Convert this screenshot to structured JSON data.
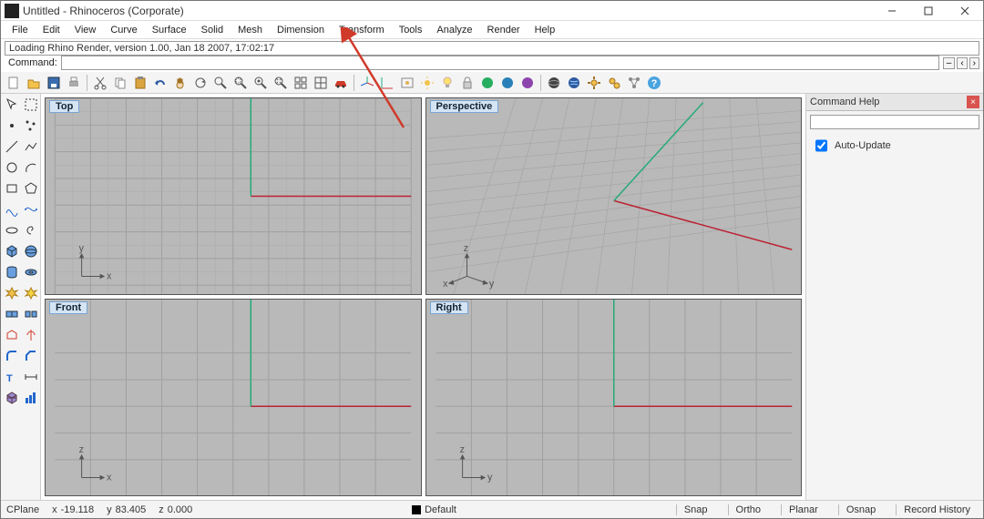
{
  "titlebar": {
    "title": "Untitled - Rhinoceros (Corporate)"
  },
  "menus": [
    "File",
    "Edit",
    "View",
    "Curve",
    "Surface",
    "Solid",
    "Mesh",
    "Dimension",
    "Transform",
    "Tools",
    "Analyze",
    "Render",
    "Help"
  ],
  "console_line": "Loading Rhino Render, version 1.00, Jan 18 2007, 17:02:17",
  "command_label": "Command:",
  "viewports": {
    "top": "Top",
    "perspective": "Perspective",
    "front": "Front",
    "right": "Right",
    "axis_x": "x",
    "axis_y": "y",
    "axis_z": "z"
  },
  "help": {
    "title": "Command Help",
    "auto_update": "Auto-Update"
  },
  "status": {
    "cplane": "CPlane",
    "x_label": "x",
    "x_val": "-19.118",
    "y_label": "y",
    "y_val": "83.405",
    "z_label": "z",
    "z_val": "0.000",
    "layer": "Default",
    "snap": "Snap",
    "ortho": "Ortho",
    "planar": "Planar",
    "osnap": "Osnap",
    "record": "Record History"
  },
  "icons": {
    "new": "#e0b050",
    "open": "#e0b050",
    "save": "#2d5aa0",
    "print": "#777",
    "cut": "#777",
    "copy": "#777",
    "paste": "#e0b050",
    "undo": "#2d5aa0",
    "redo": "#2d5aa0",
    "pan": "#777",
    "rotate": "#777",
    "zoom": "#777",
    "zoomext": "#777",
    "zoomwin": "#777",
    "zoomsel": "#777",
    "grid": "#777",
    "layers": "#777",
    "car": "#c0392b",
    "axis3": "#2d8a2d",
    "axisxy": "#2d8a2d",
    "sun": "#e0b050",
    "bulb": "#e0b050",
    "lock": "#777",
    "render1": "#27ae60",
    "render2": "#2980b9",
    "render3": "#8e44ad",
    "globe1": "#555",
    "globe2": "#2d5aa0",
    "gear": "#e0b050",
    "gears": "#e0b050",
    "net": "#777",
    "helpq": "#2d8a2d"
  }
}
